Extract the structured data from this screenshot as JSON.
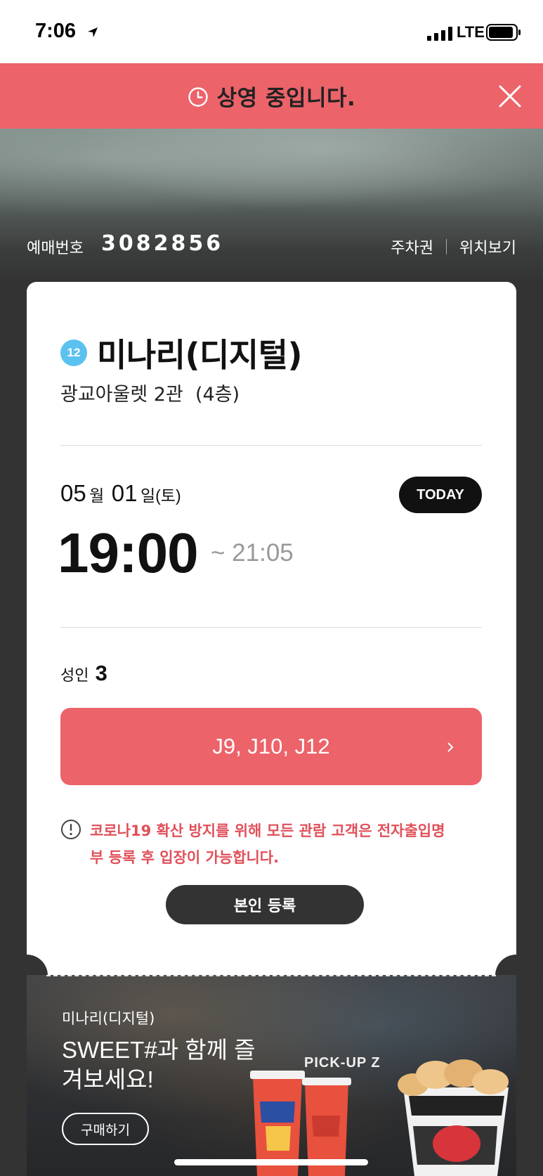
{
  "status_bar": {
    "time": "7:06",
    "network": "LTE"
  },
  "banner": {
    "text": "상영 중입니다."
  },
  "reservation": {
    "label": "예매번호",
    "number": "3082856",
    "links": [
      "주차권",
      "위치보기"
    ]
  },
  "ticket": {
    "rating": "12",
    "title": "미나리(디지털)",
    "venue": "광교아울렛 2관  (4층)",
    "date": {
      "month": "05",
      "month_unit": "월",
      "day": "01",
      "day_unit": "일(토)"
    },
    "today_badge": "TODAY",
    "start_time": "19:00",
    "end_time": "~ 21:05",
    "audience_label": "성인",
    "audience_count": "3",
    "seats": "J9, J10, J12",
    "notice": "코로나19 확산 방지를 위해 모든 관람 고객은 전자출입명부 등록 후 입장이 가능합니다.",
    "register_button": "본인 등록"
  },
  "promo": {
    "movie": "미나리(디지털)",
    "headline": "SWEET#과 함께 즐겨보세요!",
    "button": "구매하기",
    "sign_text": "PICK-UP Z"
  },
  "colors": {
    "accent": "#ec636a",
    "rating_badge": "#5bc2ef",
    "notice": "#e0505a",
    "background": "#333333"
  }
}
